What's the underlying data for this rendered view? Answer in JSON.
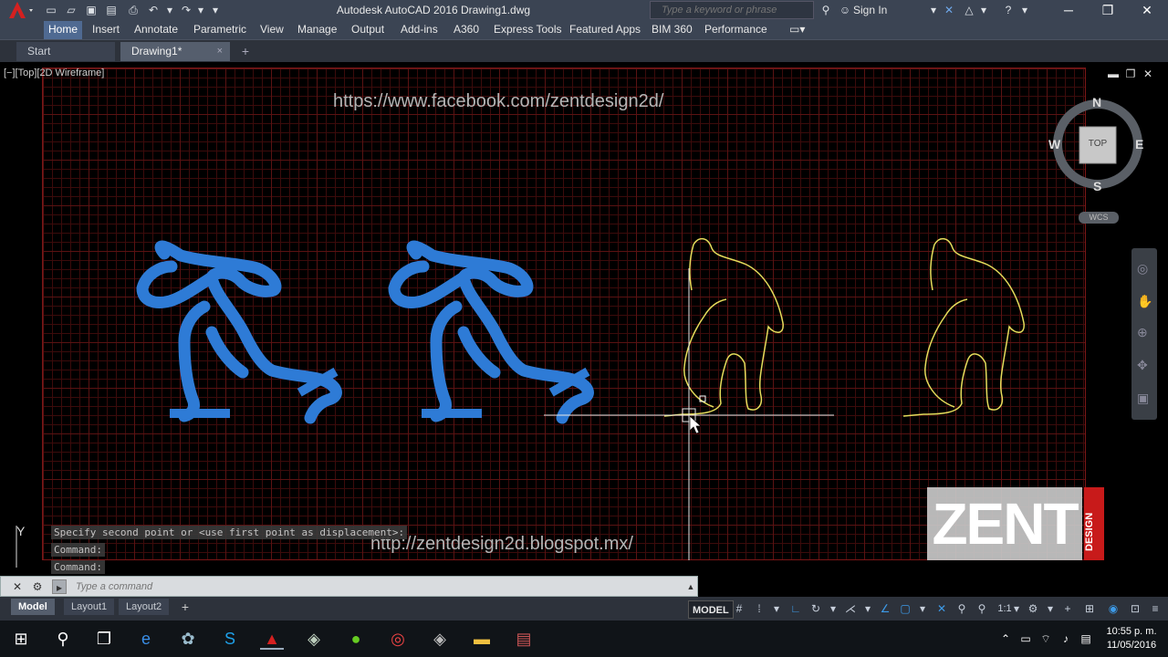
{
  "app": {
    "title": "Autodesk AutoCAD 2016    Drawing1.dwg",
    "search_placeholder": "Type a keyword or phrase",
    "sign_in": "Sign In",
    "accent": "#cc1f1f"
  },
  "menu": {
    "tabs": [
      "Home",
      "Insert",
      "Annotate",
      "Parametric",
      "View",
      "Manage",
      "Output",
      "Add-ins",
      "A360",
      "Express Tools",
      "Featured Apps",
      "BIM 360",
      "Performance"
    ]
  },
  "doc_tabs": {
    "start": "Start",
    "active": "Drawing1*",
    "close": "×",
    "plus": "+"
  },
  "viewport": {
    "label": "[−][Top][2D Wireframe]",
    "watermark_top": "https://www.facebook.com/zentdesign2d/",
    "watermark_bottom": "http://zentdesign2d.blogspot.mx/",
    "viewcube": {
      "n": "N",
      "s": "S",
      "e": "E",
      "w": "W",
      "top": "TOP",
      "wcs": "WCS"
    },
    "ucs_y": "Y",
    "logo": {
      "main": "ZENT",
      "side": "DESIGN"
    }
  },
  "command": {
    "history": [
      "Specify second point or <use first point as displacement>:",
      "Command:",
      "Command:"
    ],
    "placeholder": "Type a command"
  },
  "layout_tabs": [
    "Model",
    "Layout1",
    "Layout2"
  ],
  "status": {
    "model": "MODEL",
    "scale": "1:1"
  },
  "taskbar": {
    "time": "10:55 p. m.",
    "date": "11/05/2016"
  }
}
